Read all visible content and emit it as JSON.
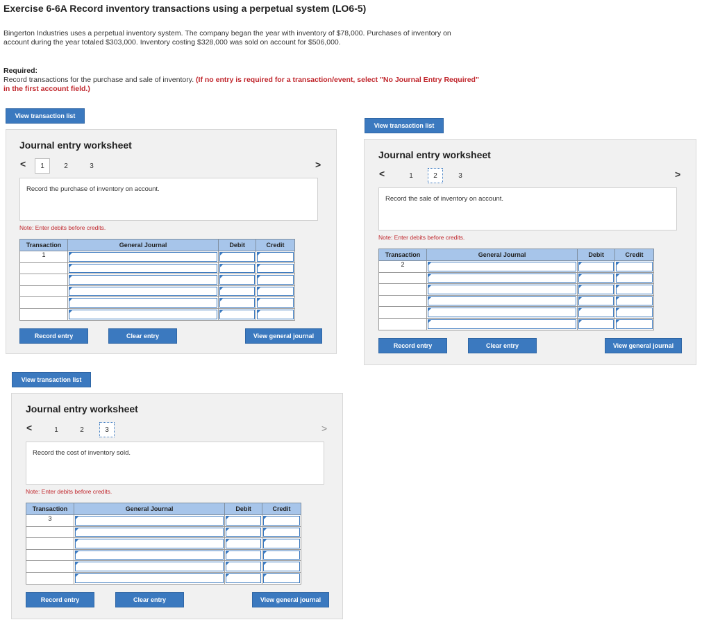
{
  "header": {
    "title": "Exercise 6-6A Record inventory transactions using a perpetual system (LO6-5)",
    "intro": "Bingerton Industries uses a perpetual inventory system. The company began the year with inventory of $78,000. Purchases of inventory on account during the year totaled $303,000. Inventory costing $328,000 was sold on account for $506,000.",
    "required_label": "Required:",
    "required_text": "Record transactions for the purchase and sale of inventory.",
    "required_note": "(If no entry is required for a transaction/event, select \"No Journal Entry Required\" in the first account field.)"
  },
  "labels": {
    "view_transaction_list": "View transaction list",
    "worksheet_title": "Journal entry worksheet",
    "note": "Note: Enter debits before credits.",
    "col_transaction": "Transaction",
    "col_general_journal": "General Journal",
    "col_debit": "Debit",
    "col_credit": "Credit",
    "record_entry": "Record entry",
    "clear_entry": "Clear entry",
    "view_general_journal": "View general journal",
    "prev_arrow": "<",
    "next_arrow": ">",
    "pages": [
      "1",
      "2",
      "3"
    ]
  },
  "worksheets": [
    {
      "prompt": "Record the purchase of inventory on account.",
      "transaction": "1"
    },
    {
      "prompt": "Record the sale of inventory on account.",
      "transaction": "2"
    },
    {
      "prompt": "Record the cost of inventory sold.",
      "transaction": "3"
    }
  ]
}
